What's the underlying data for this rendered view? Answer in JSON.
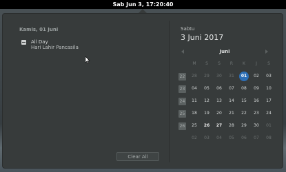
{
  "topbar": {
    "clock": "Sab Jun  3, 17:20:40"
  },
  "events": {
    "header": "Kamis, 01 Juni",
    "items": [
      {
        "time": "All Day",
        "name": "Hari Lahir Pancasila"
      }
    ]
  },
  "clear_all": "Clear All",
  "calendar": {
    "weekday": "Sabtu",
    "date": "3 Juni 2017",
    "month": "Juni",
    "day_headers": [
      "M",
      "S",
      "S",
      "R",
      "K",
      "J",
      "S"
    ],
    "week_numbers": [
      "22",
      "23",
      "24",
      "25",
      "26"
    ],
    "weeks": [
      [
        "28",
        "29",
        "30",
        "31",
        "01",
        "02",
        "03"
      ],
      [
        "04",
        "05",
        "06",
        "07",
        "08",
        "09",
        "10"
      ],
      [
        "11",
        "12",
        "13",
        "14",
        "15",
        "16",
        "17"
      ],
      [
        "18",
        "19",
        "20",
        "21",
        "22",
        "23",
        "24"
      ],
      [
        "25",
        "26",
        "27",
        "28",
        "29",
        "30",
        "01"
      ],
      [
        "02",
        "03",
        "04",
        "05",
        "06",
        "07",
        "08"
      ]
    ],
    "today": "01"
  }
}
